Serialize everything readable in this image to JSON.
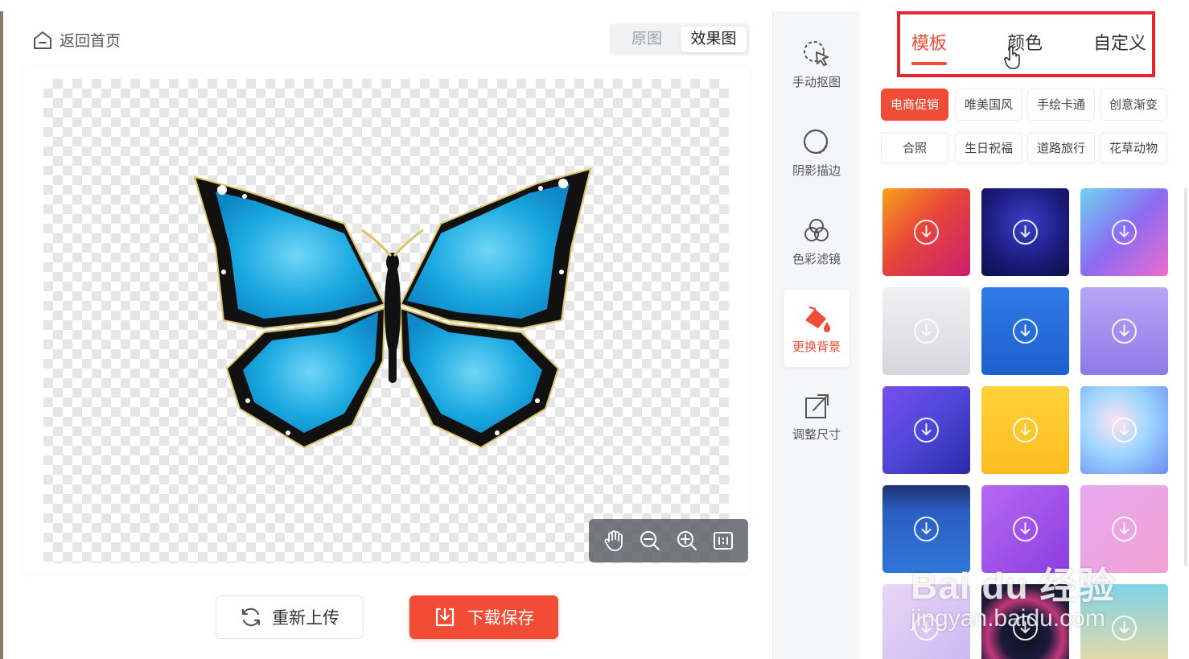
{
  "editor": {
    "back_label": "返回首页",
    "view_toggle": {
      "original": "原图",
      "effect": "效果图",
      "selected": "效果图"
    },
    "zoom_tools": [
      "hand-icon",
      "zoom-out-icon",
      "zoom-in-icon",
      "fit-1to1-icon"
    ],
    "reupload_label": "重新上传",
    "download_label": "下载保存"
  },
  "tools": [
    {
      "label": "手动抠图",
      "icon": "cursor-select-icon"
    },
    {
      "label": "阴影描边",
      "icon": "shadow-outline-icon"
    },
    {
      "label": "色彩滤镜",
      "icon": "color-filter-icon"
    },
    {
      "label": "更换背景",
      "icon": "paint-bucket-icon",
      "active": true
    },
    {
      "label": "调整尺寸",
      "icon": "resize-icon"
    }
  ],
  "panel": {
    "tabs": [
      "模板",
      "颜色",
      "自定义"
    ],
    "active_tab": "模板",
    "categories": [
      "电商促销",
      "唯美国风",
      "手绘卡通",
      "创意渐变",
      "合照",
      "生日祝福",
      "道路旅行",
      "花草动物"
    ],
    "active_category": "电商促销"
  },
  "watermark": {
    "line1": "Bai du 经验",
    "line2": "jingyan.baidu.com"
  },
  "colors": {
    "accent": "#f04c36",
    "highlight_box": "#e8262f"
  }
}
